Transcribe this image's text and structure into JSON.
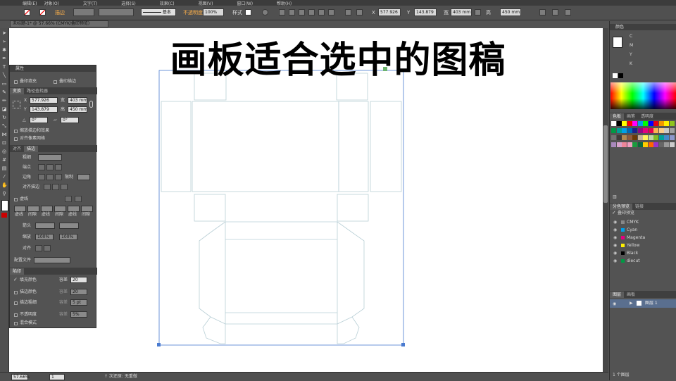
{
  "menubar": {
    "items": [
      "编辑(E)",
      "对象(O)",
      "文字(T)",
      "选择(S)",
      "效果(C)",
      "视图(V)",
      "窗口(W)",
      "帮助(H)"
    ]
  },
  "control_bar": {
    "no_selection": "描边",
    "stroke_profile": "基本",
    "opacity_label": "不透明度",
    "opacity_value": "100%",
    "style_label": "样式",
    "x_value": "577.926",
    "y_value": "143.879",
    "w_value": "403 mm",
    "h_value": "450 mm"
  },
  "document_tab": {
    "title": "未标题-1* @ 57.66% (CMYK/叠印预览)"
  },
  "headline": "画板适合选中的图稿",
  "attributes_panel": {
    "title": "属性",
    "overprint_fill": "叠印填充",
    "overprint_stroke": "叠印描边"
  },
  "transform_panel": {
    "tabs": [
      "变换",
      "路径查找器"
    ],
    "x_label": "X",
    "y_label": "Y",
    "w_label": "宽",
    "h_label": "高",
    "x_value": "577.926",
    "y_value": "143.879",
    "w_value": "403 mm",
    "h_value": "450 mm",
    "angle1": "0°",
    "angle2": "0°",
    "scale_strokes": "缩放描边和效果",
    "align_pixel": "对齐像素网格"
  },
  "stroke_panel": {
    "tabs": [
      "对齐",
      "描边"
    ],
    "weight_label": "粗细",
    "cap_label": "端点",
    "corner_label": "边角",
    "limit_label": "限制",
    "align_label": "对齐描边",
    "dashed_label": "虚线",
    "dash_labels": [
      "虚线",
      "间隙",
      "虚线",
      "间隙",
      "虚线",
      "间隙"
    ],
    "arrow_label": "箭头",
    "scale_label": "缩放",
    "scale1": "100%",
    "scale2": "100%",
    "align2_label": "对齐",
    "profile_label": "配置文件"
  },
  "trap_panel": {
    "title": "陷印",
    "fill_color": "填充颜色",
    "fill_tolerance_label": "容差",
    "fill_tolerance": "20",
    "stroke_color": "描边颜色",
    "stroke_tolerance_label": "容差",
    "stroke_tolerance": "20",
    "stroke_weight": "描边粗细",
    "weight_tolerance_label": "容差",
    "weight_tolerance": "5 pt",
    "opacity": "不透明度",
    "opacity_tolerance_label": "容差",
    "opacity_tolerance": "5%",
    "blend_mode": "混合模式"
  },
  "color_panel": {
    "title": "颜色",
    "channels": [
      "C",
      "M",
      "Y",
      "K"
    ]
  },
  "swatches_panel": {
    "tabs": [
      "色板",
      "画笔",
      "透明度"
    ],
    "colors": [
      "#ffffff",
      "#000000",
      "#ffff00",
      "#ff0000",
      "#ff00ff",
      "#00a0e9",
      "#00ff00",
      "#0000ff",
      "#e60012",
      "#f39800",
      "#fff100",
      "#8fc31f",
      "#009944",
      "#009e96",
      "#00a0e9",
      "#0068b7",
      "#1d2088",
      "#920783",
      "#e4007f",
      "#e5004f",
      "#f8b551",
      "#facd89",
      "#c9caca",
      "#9fa0a0",
      "#727171",
      "#3e3a39",
      "#b28850",
      "#8f5a3c",
      "#6a3906",
      "#c7b299",
      "#fff45c",
      "#c1d6a7",
      "#7fbe26",
      "#00a29a",
      "#448aca",
      "#8c97cb",
      "#aa89bd",
      "#d7a2cb",
      "#ee869a",
      "#f19ec2",
      "#1a9b3d",
      "#0b6b3a",
      "#ffcc00",
      "#ff6600",
      "#9933cc",
      "#666666",
      "#999999",
      "#cccccc"
    ]
  },
  "separations_panel": {
    "tabs": [
      "分色预览",
      "链接"
    ],
    "overprint_preview": "叠印预览",
    "plates": [
      {
        "name": "CMYK",
        "color": "#888888"
      },
      {
        "name": "Cyan",
        "color": "#00a0e9"
      },
      {
        "name": "Magenta",
        "color": "#e4007f"
      },
      {
        "name": "Yellow",
        "color": "#fff100"
      },
      {
        "name": "Black",
        "color": "#000000"
      },
      {
        "name": "diecut",
        "color": "#009944"
      }
    ]
  },
  "layers_panel": {
    "tabs": [
      "图层",
      "画板"
    ],
    "layer_name": "图层 1",
    "footer": "1 个图层"
  },
  "status_bar": {
    "zoom": "57.66%",
    "page": "1",
    "info": "↑ 次还原: 无重做"
  }
}
